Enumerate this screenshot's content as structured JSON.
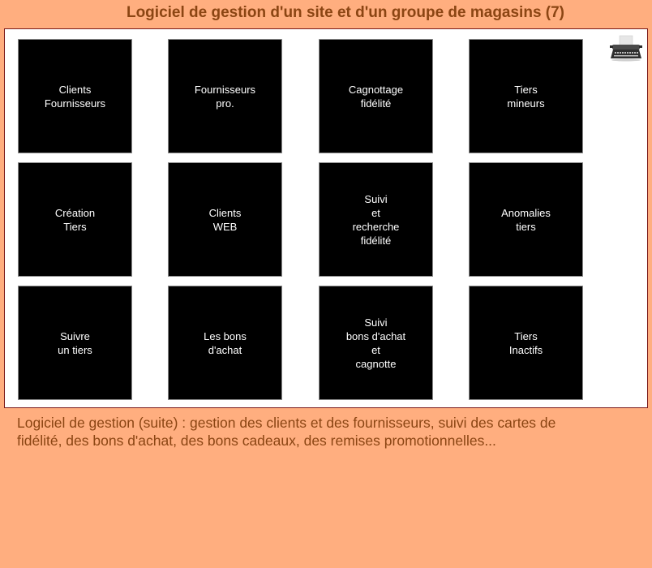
{
  "header": {
    "title": "Logiciel de gestion d'un site et d'un groupe de magasins (7)"
  },
  "frame": {
    "corner_icon": "typewriter-icon",
    "tiles": [
      {
        "label": "Clients\nFournisseurs"
      },
      {
        "label": "Fournisseurs\npro."
      },
      {
        "label": "Cagnottage\nfidélité"
      },
      {
        "label": "Tiers\nmineurs"
      },
      {
        "label": "Création\nTiers"
      },
      {
        "label": "Clients\nWEB"
      },
      {
        "label": "Suivi\net\nrecherche\nfidélité"
      },
      {
        "label": "Anomalies\ntiers"
      },
      {
        "label": "Suivre\nun tiers"
      },
      {
        "label": "Les bons\nd'achat"
      },
      {
        "label": "Suivi\nbons d'achat\net\ncagnotte"
      },
      {
        "label": "Tiers\nInactifs"
      }
    ]
  },
  "description": "Logiciel de gestion (suite) : gestion des clients et des fournisseurs, suivi des cartes de fidélité, des bons d'achat, des bons cadeaux, des remises promotionnelles...",
  "colors": {
    "background": "#ffae7f",
    "text": "#8b4513",
    "tile": "#000000",
    "frame_border": "#7a1a1a"
  }
}
